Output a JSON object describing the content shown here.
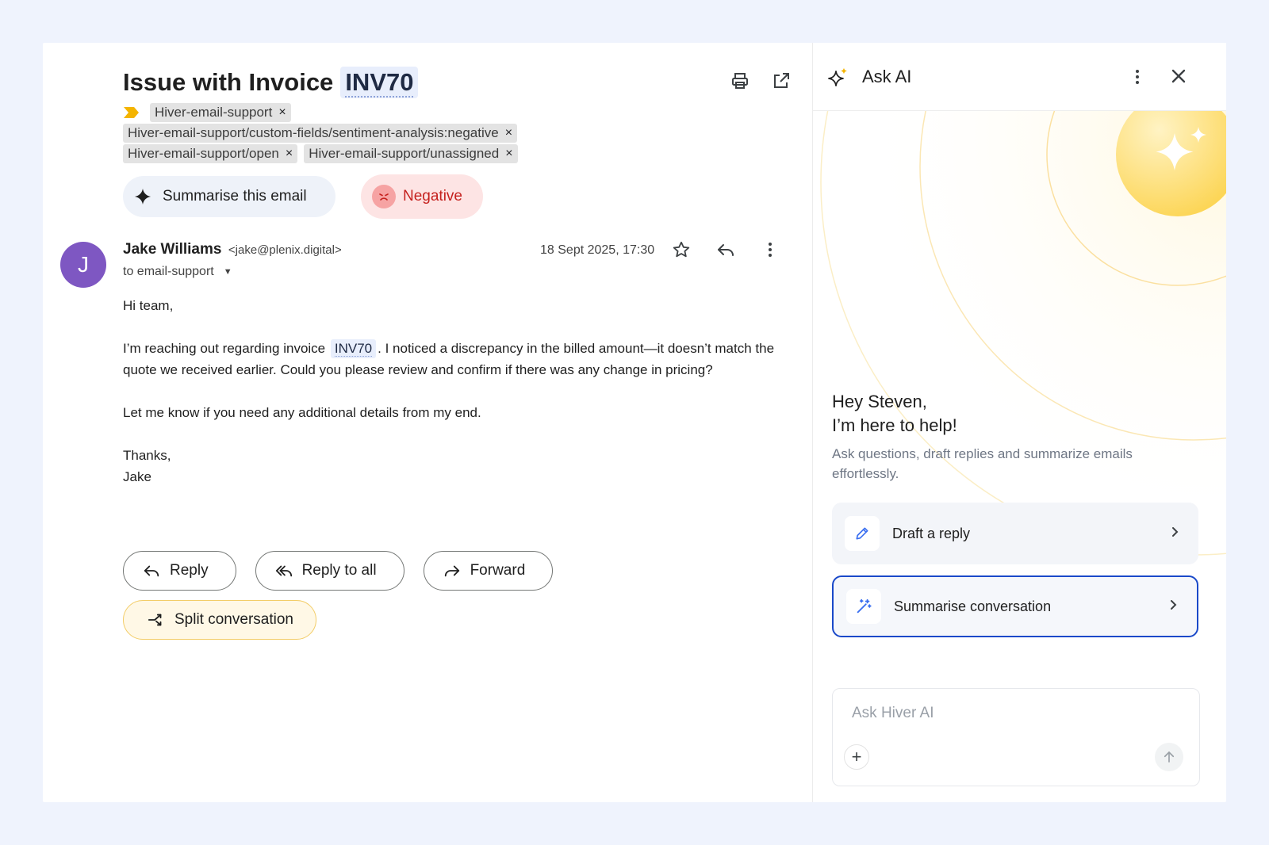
{
  "colors": {
    "page_background": "#eff3fd",
    "avatar": "#7e57c2",
    "negative_text": "#c5221f",
    "negative_bg": "#fde4e4",
    "split_border": "#f3cd68",
    "selected_card_border": "#1a49c9",
    "glow_yellow": "#fcd34d"
  },
  "email": {
    "subject": "Issue with Invoice",
    "subject_chip": "INV70",
    "icons": [
      "printer-icon",
      "open-in-new-icon"
    ],
    "labels": [
      {
        "text": "Hiver-email-support"
      },
      {
        "text": "Hiver-email-support/custom-fields/sentiment-analysis:negative"
      },
      {
        "text": "Hiver-email-support/open"
      },
      {
        "text": "Hiver-email-support/unassigned"
      }
    ],
    "label_remove_glyph": "×",
    "summarise_label": "Summarise this email",
    "sentiment_label": "Negative",
    "avatar_letter": "J",
    "sender_name": "Jake Williams",
    "sender_email": "<jake@plenix.digital>",
    "to_line": "to email-support",
    "date": "18 Sept 2025, 17:30",
    "body": {
      "greeting": "Hi team,",
      "p1_before": "I’m reaching out regarding invoice",
      "p1_chip": "INV70",
      "p1_after": ". I noticed a discrepancy in the billed amount—it doesn’t match the quote we received earlier. Could you please review and confirm if there was any change in pricing?",
      "p2": "Let me know if you need any additional details from my end.",
      "signoff": "Thanks,",
      "signature": "Jake"
    },
    "actions": {
      "reply": "Reply",
      "reply_all": "Reply to all",
      "forward": "Forward",
      "split": "Split conversation"
    }
  },
  "ai_panel": {
    "title": "Ask AI",
    "greeting_line1": "Hey Steven,",
    "greeting_line2": "I’m here to help!",
    "subtitle": "Ask questions, draft replies and summarize emails effortlessly.",
    "cards": [
      {
        "label": "Draft a reply",
        "icon": "pencil-icon",
        "selected": false
      },
      {
        "label": "Summarise conversation",
        "icon": "magic-wand-icon",
        "selected": true
      }
    ],
    "input_placeholder": "Ask Hiver AI",
    "input_value": ""
  }
}
